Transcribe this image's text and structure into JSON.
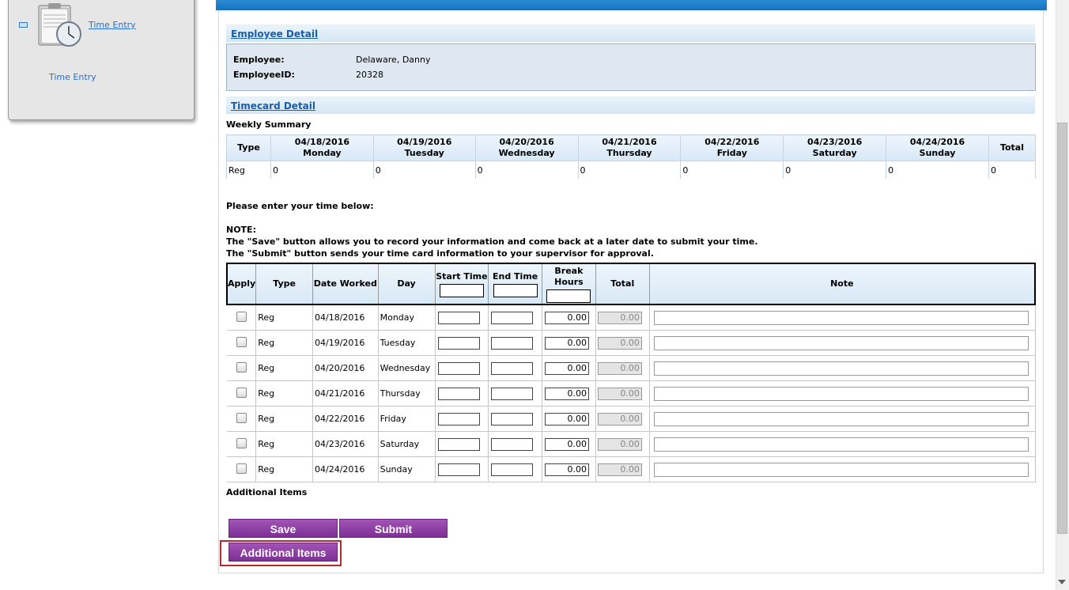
{
  "sidebar": {
    "link_label": "Time Entry",
    "sub_label": "Time Entry"
  },
  "employee_section": {
    "title": "Employee Detail",
    "employee_label": "Employee:",
    "employee_value": "Delaware, Danny",
    "id_label": "EmployeeID:",
    "id_value": "20328"
  },
  "timecard_section": {
    "title": "Timecard Detail",
    "weekly_label": "Weekly Summary"
  },
  "weekly": {
    "type_header": "Type",
    "total_header": "Total",
    "days": [
      {
        "date": "04/18/2016",
        "day": "Monday"
      },
      {
        "date": "04/19/2016",
        "day": "Tuesday"
      },
      {
        "date": "04/20/2016",
        "day": "Wednesday"
      },
      {
        "date": "04/21/2016",
        "day": "Thursday"
      },
      {
        "date": "04/22/2016",
        "day": "Friday"
      },
      {
        "date": "04/23/2016",
        "day": "Saturday"
      },
      {
        "date": "04/24/2016",
        "day": "Sunday"
      }
    ],
    "row": {
      "type": "Reg",
      "values": [
        "0",
        "0",
        "0",
        "0",
        "0",
        "0",
        "0",
        "0"
      ]
    }
  },
  "instructions": {
    "prompt": "Please enter your time below:",
    "note_label": "NOTE:",
    "note1": "The \"Save\" button allows you to record your information and come back at a later date to submit your time.",
    "note2": "The \"Submit\" button sends your time card information to your supervisor for approval."
  },
  "entry_table": {
    "headers": {
      "apply": "Apply",
      "type": "Type",
      "date": "Date Worked",
      "day": "Day",
      "start": "Start Time",
      "end": "End Time",
      "break_line1": "Break",
      "break_line2": "Hours",
      "total": "Total",
      "note": "Note"
    },
    "rows": [
      {
        "type": "Reg",
        "date": "04/18/2016",
        "day": "Monday",
        "break": "0.00",
        "total": "0.00"
      },
      {
        "type": "Reg",
        "date": "04/19/2016",
        "day": "Tuesday",
        "break": "0.00",
        "total": "0.00"
      },
      {
        "type": "Reg",
        "date": "04/20/2016",
        "day": "Wednesday",
        "break": "0.00",
        "total": "0.00"
      },
      {
        "type": "Reg",
        "date": "04/21/2016",
        "day": "Thursday",
        "break": "0.00",
        "total": "0.00"
      },
      {
        "type": "Reg",
        "date": "04/22/2016",
        "day": "Friday",
        "break": "0.00",
        "total": "0.00"
      },
      {
        "type": "Reg",
        "date": "04/23/2016",
        "day": "Saturday",
        "break": "0.00",
        "total": "0.00"
      },
      {
        "type": "Reg",
        "date": "04/24/2016",
        "day": "Sunday",
        "break": "0.00",
        "total": "0.00"
      }
    ]
  },
  "additional_label": "Additional Items",
  "buttons": {
    "save": "Save",
    "submit": "Submit",
    "additional": "Additional Items"
  },
  "colors": {
    "button_purple": "#8e3fa5",
    "header_blue": "#1a7ac8",
    "highlight_red": "#b22a2a"
  }
}
